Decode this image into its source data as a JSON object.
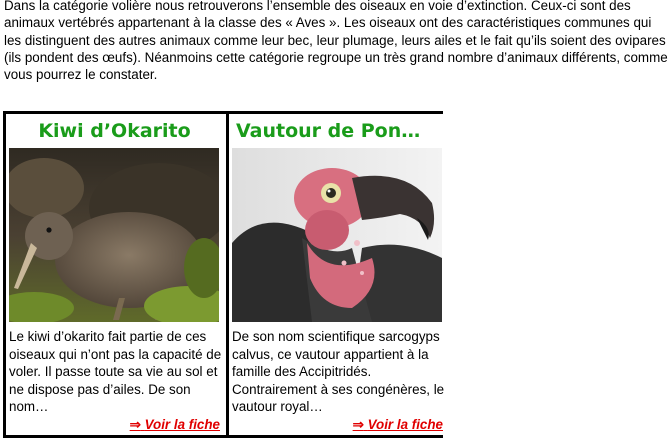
{
  "intro": "Dans la catégorie volière nous retrouverons l’ensemble des oiseaux en voie d’extinction. Ceux-ci sont des animaux vertébrés appartenant à la classe des « Aves ». Les oiseaux ont des caractéristiques communes qui les distinguent des autres animaux comme leur bec, leur plumage, leurs ailes et le fait qu’ils soient des ovipares (ils pondent des œufs). Néanmoins cette catégorie regroupe un très grand nombre d’animaux différents, comme vous pourrez le constater.",
  "cards": [
    {
      "title": "Kiwi d’Okarito",
      "description": "Le kiwi d’okarito fait partie de ces oiseaux qui n’ont pas la capacité de voler. Il passe toute sa vie au sol et ne dispose pas d’ailes. De son nom…",
      "link_arrow": "⇒",
      "link_label": "Voir la fiche"
    },
    {
      "title": "Vautour de Pon…",
      "description": "De son nom scientifique sarcogyps calvus, ce vautour appartient à la famille des Accipitridés. Contrairement à ses congénères, le vautour royal…",
      "link_arrow": "⇒",
      "link_label": "Voir la fiche"
    }
  ],
  "colors": {
    "title": "#1a9c1a",
    "link": "#e00000",
    "border": "#000000"
  }
}
